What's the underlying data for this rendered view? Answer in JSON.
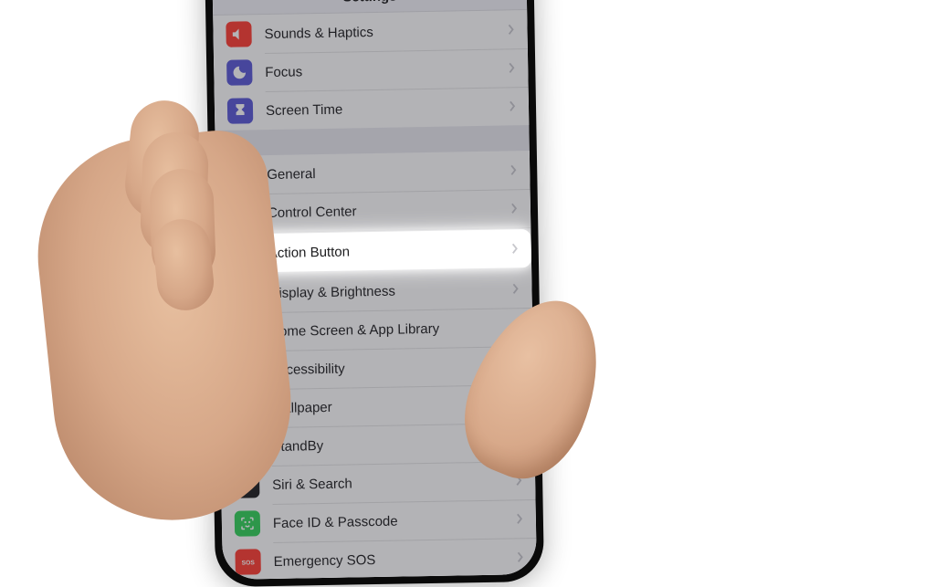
{
  "header": {
    "title": "Settings"
  },
  "sections": [
    {
      "rows": [
        {
          "id": "sounds",
          "label": "Sounds & Haptics",
          "icon": "speaker-icon",
          "color": "#ff3b30"
        },
        {
          "id": "focus",
          "label": "Focus",
          "icon": "moon-icon",
          "color": "#5856d6"
        },
        {
          "id": "screen",
          "label": "Screen Time",
          "icon": "hourglass-icon",
          "color": "#5856d6"
        }
      ]
    },
    {
      "rows": [
        {
          "id": "general",
          "label": "General",
          "icon": "gear-icon",
          "color": "#8e8e93"
        },
        {
          "id": "control",
          "label": "Control Center",
          "icon": "switches-icon",
          "color": "#8e8e93"
        },
        {
          "id": "action",
          "label": "Action Button",
          "icon": "action-icon",
          "color": "#007aff",
          "highlighted": true
        },
        {
          "id": "display",
          "label": "Display & Brightness",
          "icon": "sun-icon",
          "color": "#007aff"
        },
        {
          "id": "home",
          "label": "Home Screen & App Library",
          "icon": "grid-icon",
          "color": "#5856d6"
        },
        {
          "id": "access",
          "label": "Accessibility",
          "icon": "person-icon",
          "color": "#007aff"
        },
        {
          "id": "wall",
          "label": "Wallpaper",
          "icon": "flower-icon",
          "color": "#34c7c2"
        },
        {
          "id": "standby",
          "label": "StandBy",
          "icon": "standby-icon",
          "color": "#1c1c1e"
        },
        {
          "id": "siri",
          "label": "Siri & Search",
          "icon": "siri-icon",
          "color": "#1c1c1e"
        },
        {
          "id": "faceid",
          "label": "Face ID & Passcode",
          "icon": "faceid-icon",
          "color": "#30d158"
        },
        {
          "id": "sos",
          "label": "Emergency SOS",
          "icon": "sos-icon",
          "color": "#ff3b30"
        }
      ]
    }
  ]
}
